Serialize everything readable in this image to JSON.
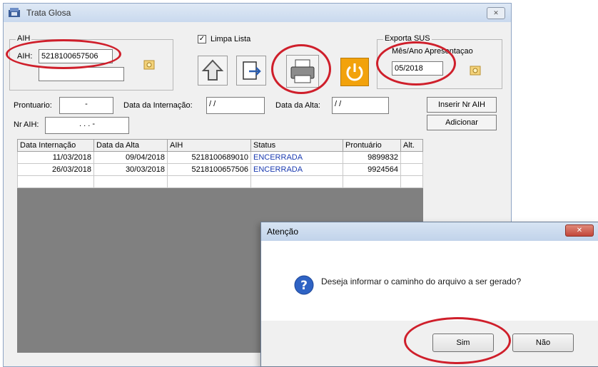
{
  "window": {
    "title": "Trata Glosa",
    "close": "✕"
  },
  "aih_group": {
    "label": "AIH",
    "field_label": "AIH:",
    "value": "5218100657506",
    "second_value": ""
  },
  "limpa_lista": {
    "label": "Limpa Lista",
    "checked": true
  },
  "export_group": {
    "label": "Exporta SUS",
    "mes_ano_label": "Mês/Ano Apresentaçao",
    "mes_ano_value": "05/2018"
  },
  "form": {
    "prontuario_label": "Prontuario:",
    "prontuario_value": "-",
    "data_internacao_label": "Data da Internação:",
    "data_internacao_value": "/ /",
    "data_alta_label": "Data da Alta:",
    "data_alta_value": "/ /",
    "nr_aih_label": "Nr AIH:",
    "nr_aih_value": ". . . -",
    "inserir_button": "Inserir Nr AIH",
    "adicionar_button": "Adicionar"
  },
  "table": {
    "headers": [
      "Data Internação",
      "Data da Alta",
      "AIH",
      "Status",
      "Prontuário",
      "Alt."
    ],
    "rows": [
      [
        "11/03/2018",
        "09/04/2018",
        "5218100689010",
        "ENCERRADA",
        "9899832",
        ""
      ],
      [
        "26/03/2018",
        "30/03/2018",
        "5218100657506",
        "ENCERRADA",
        "9924564",
        ""
      ]
    ]
  },
  "dialog": {
    "title": "Atenção",
    "message": "Deseja informar o caminho do arquivo a ser gerado?",
    "yes_button": "Sim",
    "no_button": "Não",
    "close": "✕"
  },
  "colors": {
    "annotation": "#cf1f2b",
    "status_text": "#1b3bb0",
    "power_button": "#f2a20c"
  }
}
